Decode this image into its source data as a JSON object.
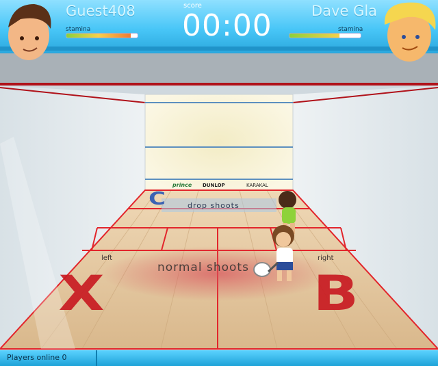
{
  "player1": {
    "name": "Guest408",
    "stamina_label": "stamina",
    "stamina": 0.9
  },
  "player2": {
    "name": "Dave Gla",
    "stamina_label": "stamina",
    "stamina": 0.7
  },
  "score": {
    "label": "score",
    "timer": "00:00"
  },
  "wall_sponsors": [
    "prince",
    "DUNLOP",
    "KARAKAL"
  ],
  "court_zones": {
    "drop_zone_label": "drop shoots",
    "drop_zone_key": "C",
    "normal_zone_label": "normal shoots",
    "left_label": "left",
    "right_label": "right",
    "left_key": "X",
    "right_key": "B"
  },
  "status_bar": {
    "players_online": "Players online 0"
  },
  "colors": {
    "hud": "#48c6f7",
    "court_line": "#e2252b",
    "floor": "#e3c7a0",
    "key_letter": "#c81820"
  }
}
